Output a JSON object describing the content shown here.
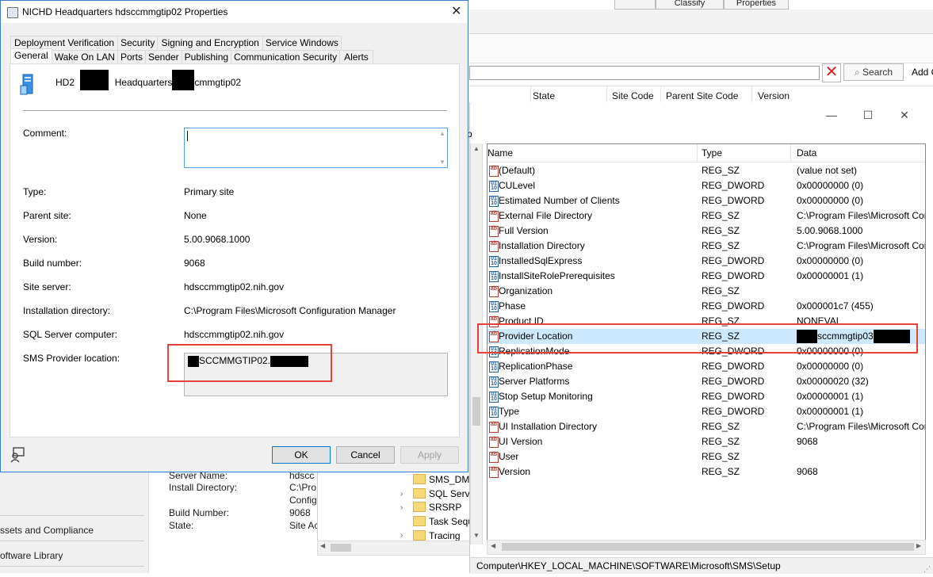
{
  "console": {
    "tabs": [
      "Classify",
      "Properties"
    ],
    "search_button": "Search",
    "add_criteria": "Add C",
    "columns": [
      "State",
      "Site Code",
      "Parent Site Code",
      "Version"
    ],
    "nav": [
      "ssets and Compliance",
      "oftware Library"
    ],
    "details": [
      {
        "label": "Server Name:",
        "value": "hdscc"
      },
      {
        "label": "Install Directory:",
        "value": "C:\\Pro"
      },
      {
        "label": "",
        "value": "Config"
      },
      {
        "label": "Build Number:",
        "value": "9068"
      },
      {
        "label": "State:",
        "value": "Site Ac"
      }
    ],
    "tree": [
      "SMS_DMP",
      "SQL Serve",
      "SRSRP",
      "Task Sequ",
      "Tracing"
    ]
  },
  "regedit": {
    "caption_minimize": "—",
    "caption_maximize": "☐",
    "caption_close": "✕",
    "left_fragment": "p",
    "columns": {
      "name": "Name",
      "type": "Type",
      "data": "Data"
    },
    "rows": [
      {
        "name": "(Default)",
        "type": "REG_SZ",
        "data": "(value not set)",
        "kind": "sz"
      },
      {
        "name": "CULevel",
        "type": "REG_DWORD",
        "data": "0x00000000 (0)",
        "kind": "dw"
      },
      {
        "name": "Estimated Number of Clients",
        "type": "REG_DWORD",
        "data": "0x00000000 (0)",
        "kind": "dw"
      },
      {
        "name": "External File Directory",
        "type": "REG_SZ",
        "data": "C:\\Program Files\\Microsoft Cor",
        "kind": "sz"
      },
      {
        "name": "Full Version",
        "type": "REG_SZ",
        "data": "5.00.9068.1000",
        "kind": "sz"
      },
      {
        "name": "Installation Directory",
        "type": "REG_SZ",
        "data": "C:\\Program Files\\Microsoft Cor",
        "kind": "sz"
      },
      {
        "name": "InstalledSqlExpress",
        "type": "REG_DWORD",
        "data": "0x00000000 (0)",
        "kind": "dw"
      },
      {
        "name": "InstallSiteRolePrerequisites",
        "type": "REG_DWORD",
        "data": "0x00000001 (1)",
        "kind": "dw"
      },
      {
        "name": "Organization",
        "type": "REG_SZ",
        "data": "",
        "kind": "sz"
      },
      {
        "name": "Phase",
        "type": "REG_DWORD",
        "data": "0x000001c7 (455)",
        "kind": "dw"
      },
      {
        "name": "Product ID",
        "type": "REG_SZ",
        "data": "NONEVAL",
        "kind": "sz"
      },
      {
        "name": "Provider Location",
        "type": "REG_SZ",
        "data": "sccmmgtip03",
        "kind": "sz",
        "selected": true
      },
      {
        "name": "ReplicationMode",
        "type": "REG_DWORD",
        "data": "0x00000000 (0)",
        "kind": "dw"
      },
      {
        "name": "ReplicationPhase",
        "type": "REG_DWORD",
        "data": "0x00000000 (0)",
        "kind": "dw"
      },
      {
        "name": "Server Platforms",
        "type": "REG_DWORD",
        "data": "0x00000020 (32)",
        "kind": "dw"
      },
      {
        "name": "Stop Setup Monitoring",
        "type": "REG_DWORD",
        "data": "0x00000001 (1)",
        "kind": "dw"
      },
      {
        "name": "Type",
        "type": "REG_DWORD",
        "data": "0x00000001 (1)",
        "kind": "dw"
      },
      {
        "name": "UI Installation Directory",
        "type": "REG_SZ",
        "data": "C:\\Program Files\\Microsoft Cor",
        "kind": "sz"
      },
      {
        "name": "UI Version",
        "type": "REG_SZ",
        "data": "9068",
        "kind": "sz"
      },
      {
        "name": "User",
        "type": "REG_SZ",
        "data": "",
        "kind": "sz"
      },
      {
        "name": "Version",
        "type": "REG_SZ",
        "data": "9068",
        "kind": "sz"
      }
    ],
    "status_path": "Computer\\HKEY_LOCAL_MACHINE\\SOFTWARE\\Microsoft\\SMS\\Setup"
  },
  "dialog": {
    "title": "NICHD Headquarters hdsccmmgtip02 Properties",
    "close_glyph": "✕",
    "tabs_row1": [
      "Deployment Verification",
      "Security",
      "Signing and Encryption",
      "Service Windows"
    ],
    "tabs_row2": [
      "General",
      "Wake On LAN",
      "Ports",
      "Sender",
      "Publishing",
      "Communication Security",
      "Alerts"
    ],
    "active_tab": "General",
    "header_prefix": "HD2",
    "header_middle": "Headquarters",
    "header_suffix": "cmmgtip02",
    "fields": {
      "comment_label": "Comment:",
      "type_label": "Type:",
      "type_value": "Primary site",
      "parent_label": "Parent site:",
      "parent_value": "None",
      "version_label": "Version:",
      "version_value": "5.00.9068.1000",
      "build_label": "Build number:",
      "build_value": "9068",
      "server_label": "Site server:",
      "server_value": "hdsccmmgtip02.nih.gov",
      "installdir_label": "Installation directory:",
      "installdir_value": "C:\\Program Files\\Microsoft Configuration Manager",
      "sql_label": "SQL Server computer:",
      "sql_value": "hdsccmmgtip02.nih.gov",
      "sms_label": "SMS Provider location:",
      "sms_value": "SCCMMGTIP02."
    },
    "buttons": {
      "ok": "OK",
      "cancel": "Cancel",
      "apply": "Apply"
    }
  },
  "colors": {
    "highlight_box": "#e8413a",
    "selection": "#cce8ff",
    "dialog_border": "#3a7ed3"
  }
}
